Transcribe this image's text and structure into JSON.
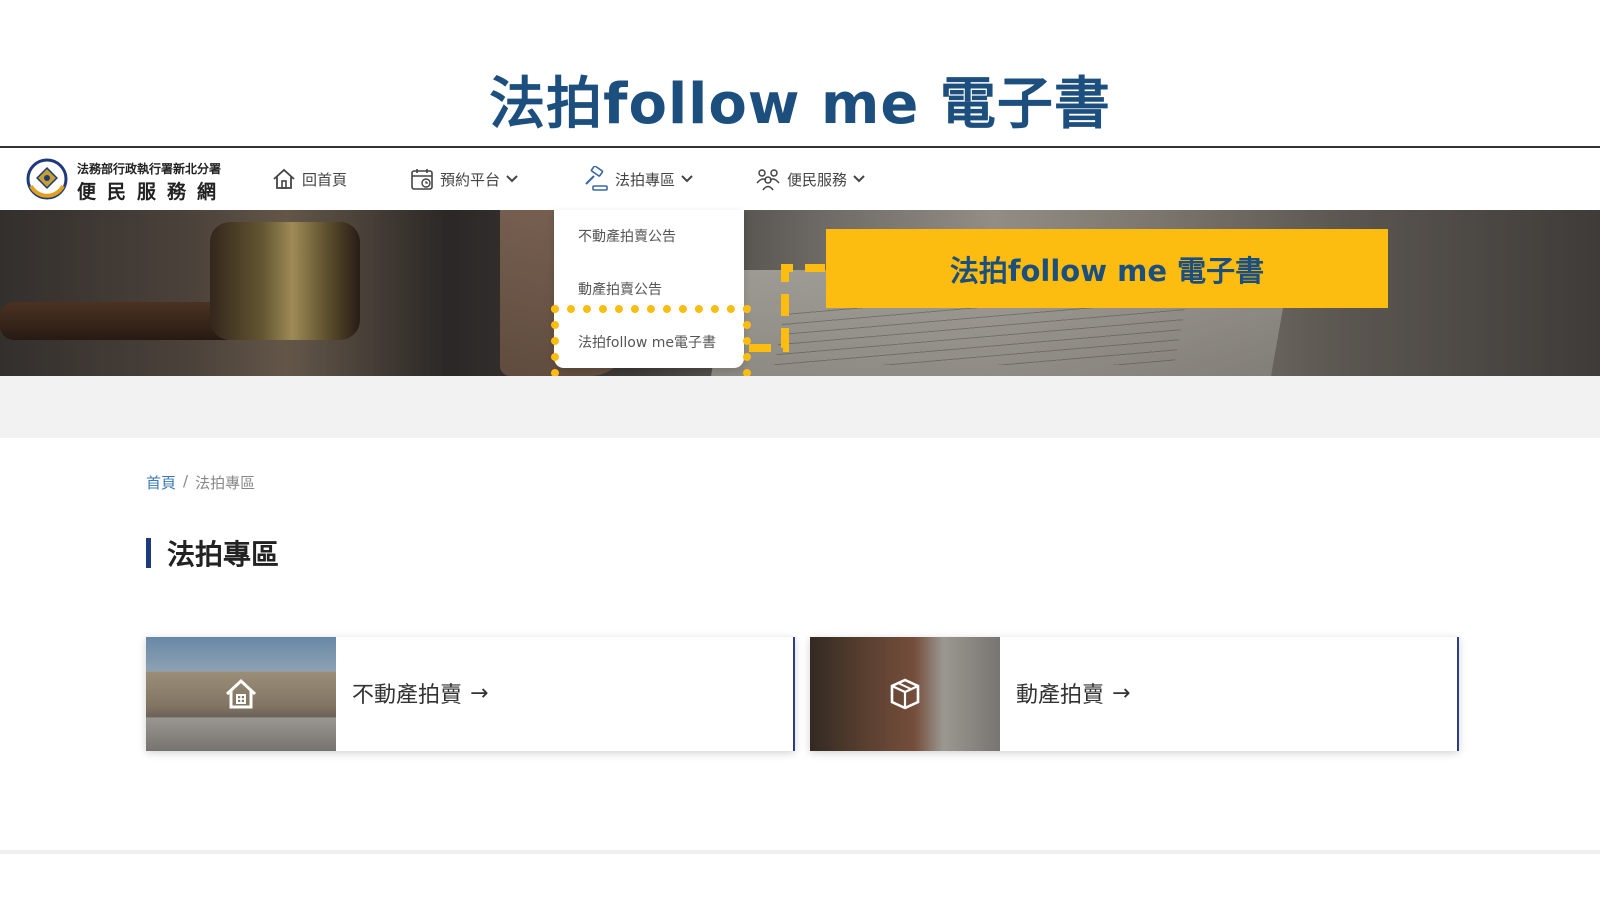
{
  "slide": {
    "title": "法拍follow me 電子書"
  },
  "header": {
    "logo_small": "法務部行政執行署新北分署",
    "logo_big": "便民服務網"
  },
  "nav": {
    "home": "回首頁",
    "booking": "預約平台",
    "auction": "法拍專區",
    "service": "便民服務"
  },
  "dropdown": {
    "items": [
      "不動產拍賣公告",
      "動產拍賣公告",
      "法拍follow me電子書"
    ]
  },
  "callout": {
    "label": "法拍follow me 電子書"
  },
  "breadcrumb": {
    "home": "首頁",
    "separator": "/",
    "current": "法拍專區"
  },
  "page": {
    "title": "法拍專區"
  },
  "cards": [
    {
      "label": "不動產拍賣",
      "arrow": "→",
      "icon": "house-icon"
    },
    {
      "label": "動產拍賣",
      "arrow": "→",
      "icon": "box-icon"
    }
  ],
  "colors": {
    "accent_yellow": "#fdbd10",
    "title_blue": "#1d4f7e",
    "bar_navy": "#1f3a7a",
    "link_blue": "#3a78b8"
  }
}
